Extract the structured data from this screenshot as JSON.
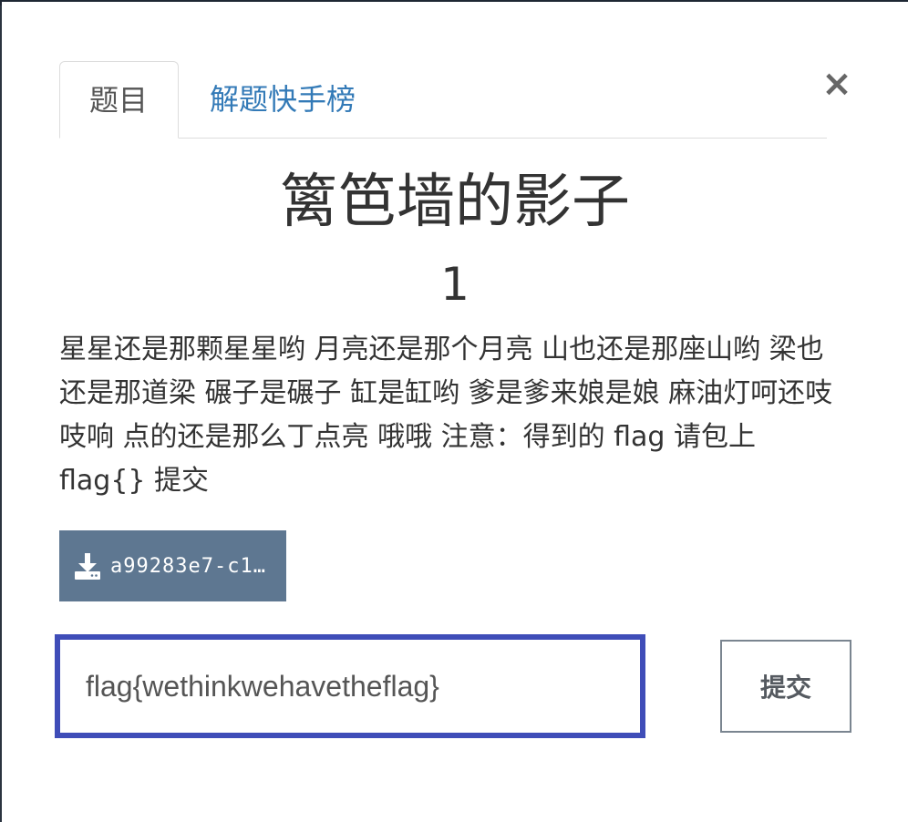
{
  "tabs": {
    "challenge_label": "题目",
    "leaderboard_label": "解题快手榜"
  },
  "close": {
    "symbol": "×"
  },
  "challenge": {
    "title": "篱笆墙的影子",
    "score": "1",
    "description": "星星还是那颗星星哟 月亮还是那个月亮 山也还是那座山哟 梁也还是那道梁 碾子是碾子 缸是缸哟 爹是爹来娘是娘 麻油灯呵还吱吱响 点的还是那么丁点亮 哦哦 注意：得到的 flag 请包上 flag{} 提交"
  },
  "attachment": {
    "label": "a99283e7-c1…",
    "icon": "download-icon"
  },
  "form": {
    "flag_value": "flag{wethinkwehavetheflag}",
    "submit_label": "提交"
  },
  "colors": {
    "accent_link": "#337ab7",
    "download_button": "#5e7791",
    "input_focus_border": "#3f4db8"
  }
}
